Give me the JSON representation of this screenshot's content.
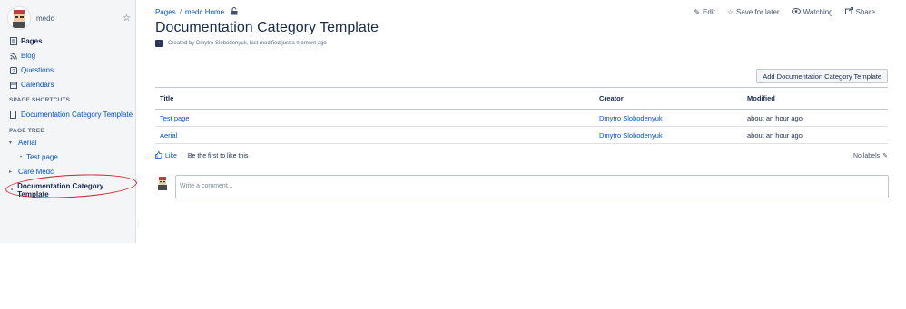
{
  "sidebar": {
    "space_name": "medc",
    "nav": [
      {
        "label": "Pages",
        "icon": "pages-icon",
        "active": true
      },
      {
        "label": "Blog",
        "icon": "rss-icon"
      },
      {
        "label": "Questions",
        "icon": "question-icon"
      },
      {
        "label": "Calendars",
        "icon": "calendar-icon"
      }
    ],
    "shortcuts_heading": "SPACE SHORTCUTS",
    "shortcuts": [
      {
        "label": "Documentation Category Template"
      }
    ],
    "tree_heading": "PAGE TREE",
    "tree": [
      {
        "label": "Aerial"
      },
      {
        "label": "Test page"
      },
      {
        "label": "Care Medc"
      },
      {
        "label": "Documentation Category Template"
      }
    ]
  },
  "breadcrumb": {
    "items": [
      "Pages",
      "medc Home"
    ],
    "separator": "/"
  },
  "actions": {
    "edit": "Edit",
    "save_for_later": "Save for later",
    "watching": "Watching",
    "share": "Share"
  },
  "page": {
    "title": "Documentation Category Template",
    "byline": "Created by Dmytro Slobodenyuk, last modified just a moment ago"
  },
  "add_button": "Add Documentation Category Template",
  "table": {
    "headers": [
      "Title",
      "Creator",
      "Modified"
    ],
    "rows": [
      {
        "title": "Test page",
        "creator": "Dmytro Slobodenyuk",
        "modified": "about an hour ago"
      },
      {
        "title": "Aerial",
        "creator": "Dmytro Slobodenyuk",
        "modified": "about an hour ago"
      }
    ]
  },
  "like": {
    "label": "Like",
    "first": "Be the first to like this"
  },
  "labels": "No labels",
  "comment": {
    "placeholder": "Write a comment..."
  }
}
